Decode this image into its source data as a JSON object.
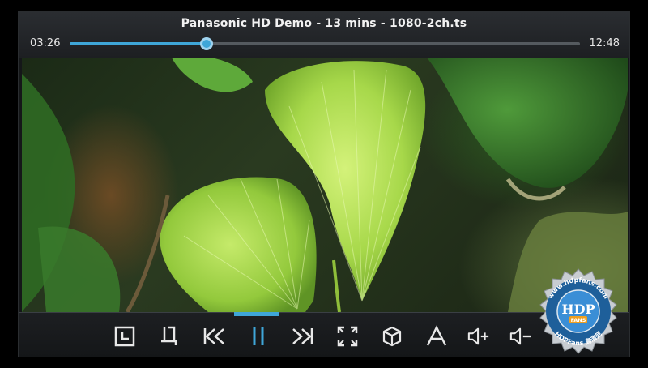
{
  "player": {
    "title": "Panasonic HD Demo - 13 mins - 1080-2ch.ts",
    "elapsed": "03:26",
    "total": "12:48",
    "progress_fraction": 0.268
  },
  "controls": [
    {
      "name": "sleep-timer-button",
      "icon": "clock-icon"
    },
    {
      "name": "crop-button",
      "icon": "crop-icon"
    },
    {
      "name": "previous-button",
      "icon": "skip-back-icon"
    },
    {
      "name": "pause-button",
      "icon": "pause-icon"
    },
    {
      "name": "next-button",
      "icon": "skip-forward-icon"
    },
    {
      "name": "fullscreen-button",
      "icon": "fullscreen-icon"
    },
    {
      "name": "3d-button",
      "icon": "cube-icon"
    },
    {
      "name": "subtitle-button",
      "icon": "text-a-icon"
    },
    {
      "name": "volume-up-button",
      "icon": "volume-plus-icon"
    },
    {
      "name": "volume-down-button",
      "icon": "volume-minus-icon"
    }
  ],
  "watermark": {
    "logo_text": "HDP",
    "url_text": "www.hdpfans.com",
    "bottom_text": "HDPFans 高清范",
    "badge": "FANS"
  },
  "colors": {
    "accent": "#3fa6d8",
    "icon": "#e8e8e8",
    "bar": "#1d1f22"
  }
}
